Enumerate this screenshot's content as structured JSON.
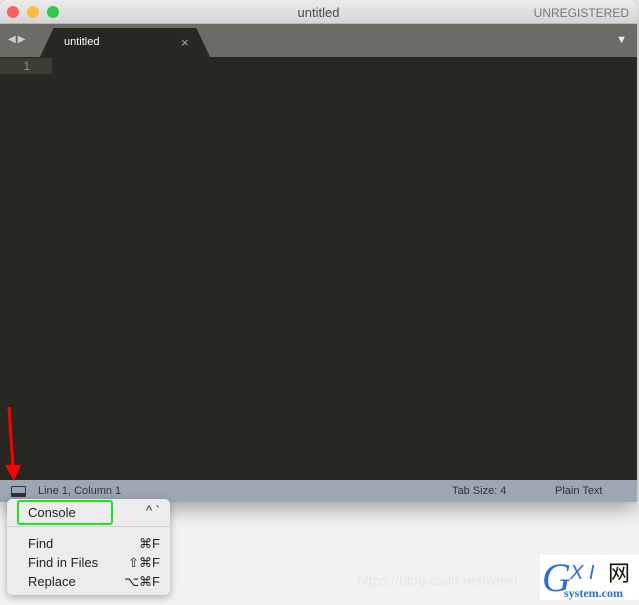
{
  "window": {
    "title": "untitled",
    "registration": "UNREGISTERED"
  },
  "tabs": [
    {
      "label": "untitled",
      "close_icon": "×"
    }
  ],
  "editor": {
    "line_numbers": [
      "1"
    ]
  },
  "status": {
    "position": "Line 1, Column 1",
    "tab_size": "Tab Size: 4",
    "syntax": "Plain Text"
  },
  "menu": {
    "items": [
      {
        "label": "Console",
        "shortcut": "^ `"
      },
      {
        "label": "Find",
        "shortcut": "⌘F"
      },
      {
        "label": "Find in Files",
        "shortcut": "⇧⌘F"
      },
      {
        "label": "Replace",
        "shortcut": "⌥⌘F"
      }
    ]
  },
  "watermark": "https://blog.csdn.net/weixi",
  "logo": {
    "text": "GXI网",
    "sub": "system.com"
  },
  "colors": {
    "highlight": "#22e022",
    "arrow": "#ff0000"
  }
}
